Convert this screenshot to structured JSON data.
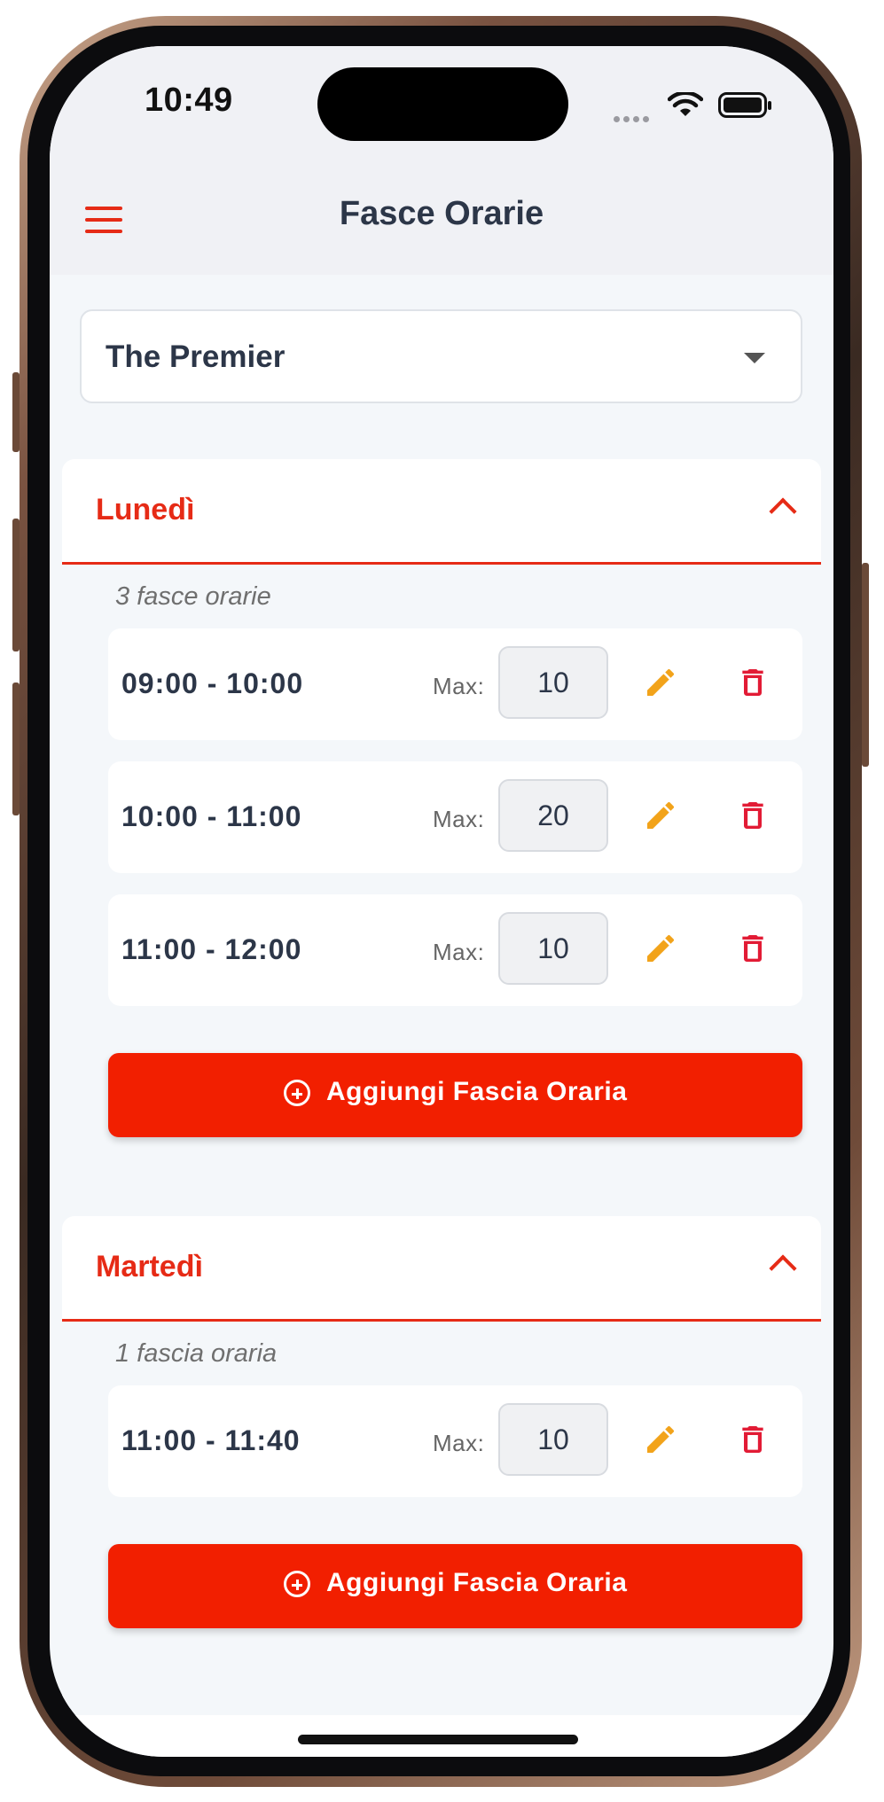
{
  "status_bar": {
    "time": "10:49"
  },
  "header": {
    "title": "Fasce Orarie"
  },
  "venue_select": {
    "value": "The Premier"
  },
  "days": [
    {
      "name": "Lunedì",
      "count_label": "3 fasce orarie",
      "slots": [
        {
          "time": "09:00 - 10:00",
          "max_label": "Max:",
          "max": "10"
        },
        {
          "time": "10:00 - 11:00",
          "max_label": "Max:",
          "max": "20"
        },
        {
          "time": "11:00 - 12:00",
          "max_label": "Max:",
          "max": "10"
        }
      ],
      "add_label": "Aggiungi Fascia Oraria"
    },
    {
      "name": "Martedì",
      "count_label": "1 fascia oraria",
      "slots": [
        {
          "time": "11:00 - 11:40",
          "max_label": "Max:",
          "max": "10"
        }
      ],
      "add_label": "Aggiungi Fascia Oraria"
    }
  ],
  "colors": {
    "accent": "#e62b16",
    "button": "#f21f00",
    "edit": "#f2a31a",
    "delete": "#e21b35"
  },
  "icons": {
    "menu": "hamburger-icon",
    "edit": "pencil-icon",
    "delete": "trash-icon",
    "add": "plus-circle-icon",
    "collapse": "chevron-up-icon"
  }
}
